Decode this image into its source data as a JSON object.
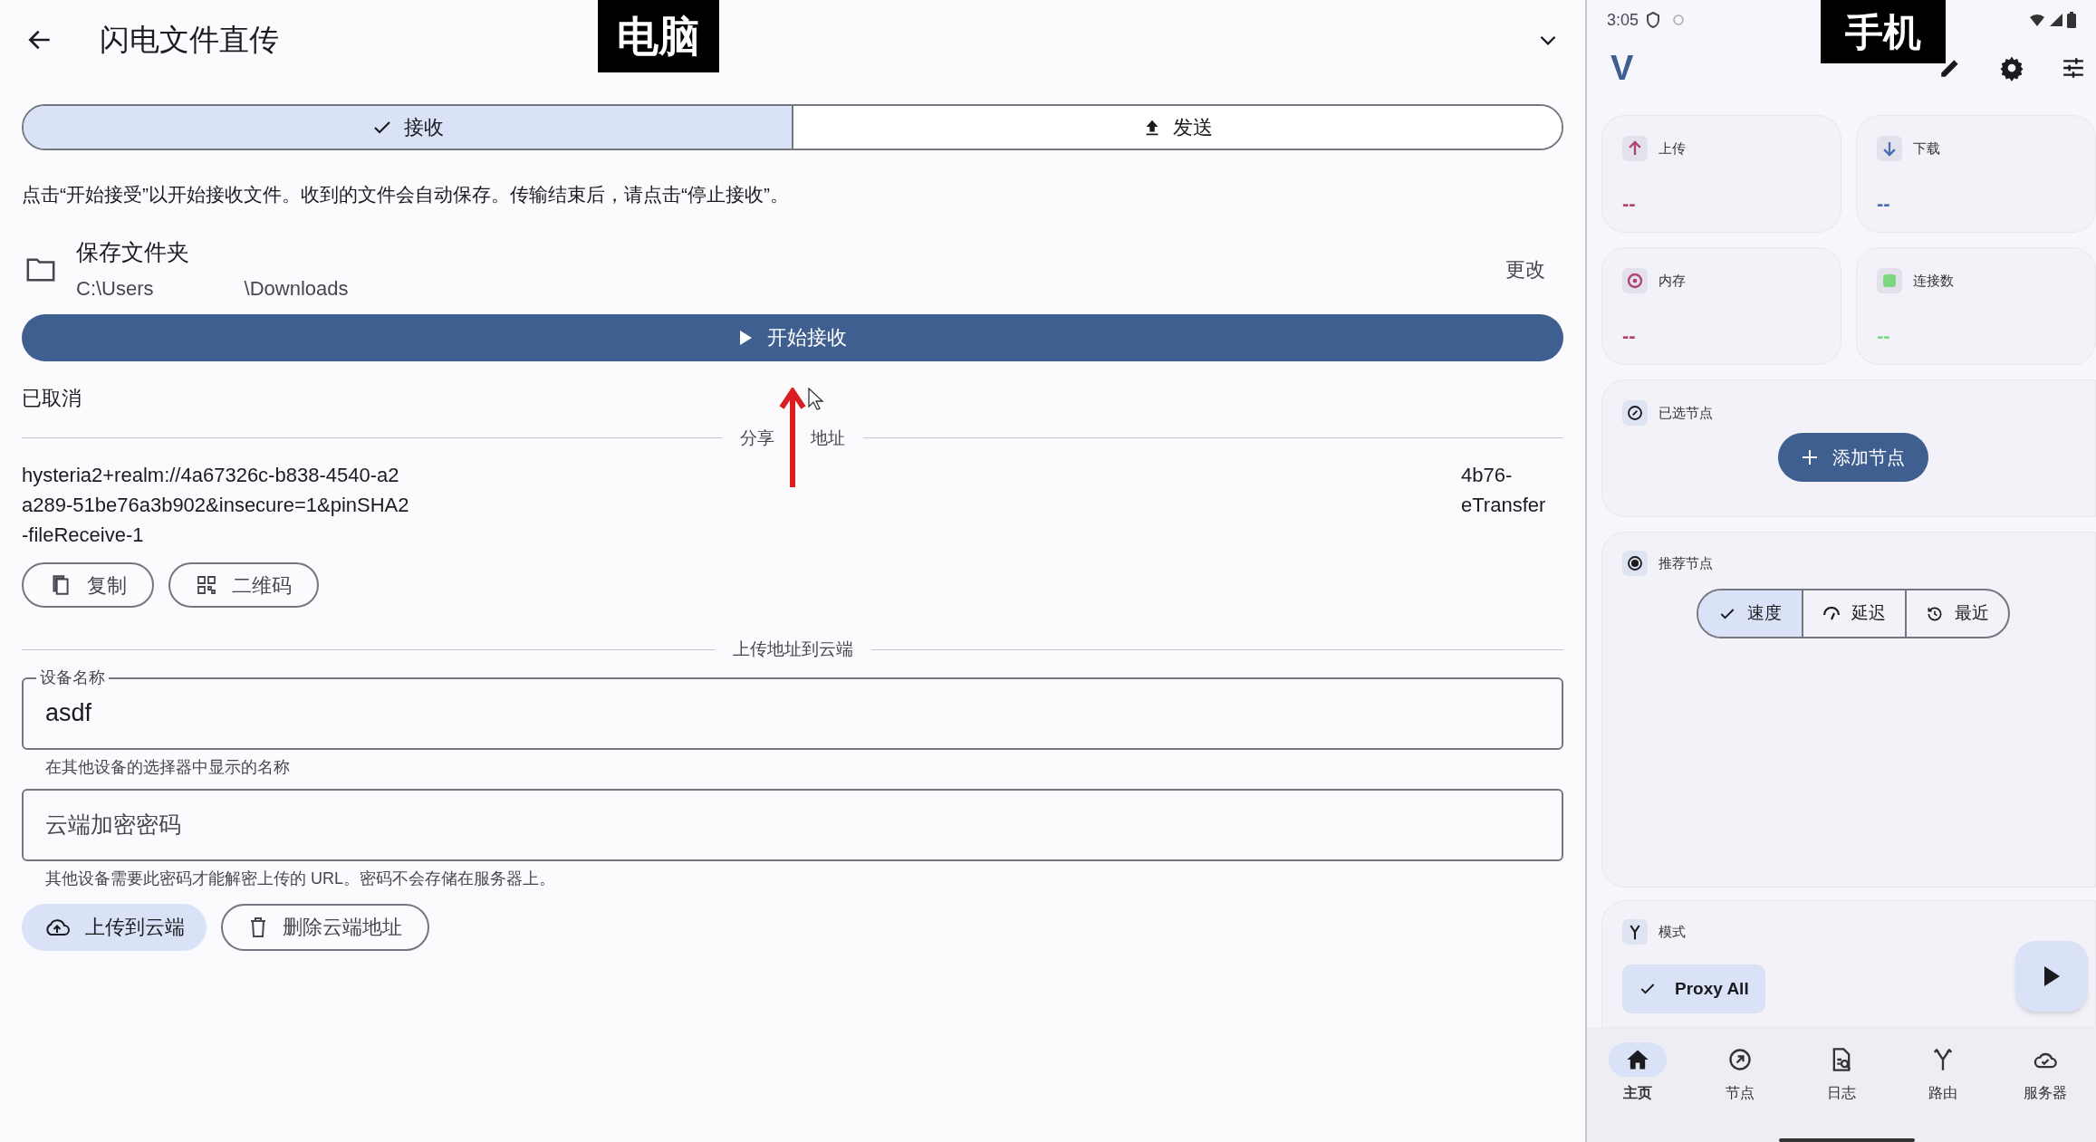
{
  "annotations": {
    "desktop_label": "电脑",
    "phone_label": "手机"
  },
  "desktop": {
    "title": "闪电文件直传",
    "tabs": [
      {
        "label": "接收",
        "kind": "receive",
        "selected": true
      },
      {
        "label": "发送",
        "kind": "send",
        "selected": false
      }
    ],
    "instruction": "点击“开始接受”以开始接收文件。收到的文件会自动保存。传输结束后，请点击“停止接收”。",
    "folder": {
      "label": "保存文件夹",
      "path_start": "C:\\Users",
      "path_end": "\\Downloads",
      "change": "更改"
    },
    "start_button": "开始接收",
    "status": "已取消",
    "share_divider": {
      "left": "分享",
      "right": "地址"
    },
    "share_url": [
      {
        "left": "hysteria2+realm://4a67326c-b838-4540-a2",
        "right": "4b76-"
      },
      {
        "left": "a289-51be76a3b902&insecure=1&pinSHA2",
        "right": "eTransfer"
      },
      {
        "left": "-fileReceive-1"
      }
    ],
    "share_buttons": [
      {
        "label": "复制",
        "kind": "copy"
      },
      {
        "label": "二维码",
        "kind": "qr"
      }
    ],
    "upload_divider": "上传地址到云端",
    "device_field": {
      "label": "设备名称",
      "value": "asdf",
      "helper": "在其他设备的选择器中显示的名称"
    },
    "password_field": {
      "placeholder": "云端加密密码",
      "helper": "其他设备需要此密码才能解密上传的 URL。密码不会存储在服务器上。"
    },
    "cloud_buttons": [
      {
        "label": "上传到云端",
        "kind": "upload",
        "filled": true
      },
      {
        "label": "删除云端地址",
        "kind": "delete",
        "filled": false
      }
    ]
  },
  "phone": {
    "status_bar": {
      "time": "3:05"
    },
    "logo": "V",
    "stats": [
      {
        "label": "上传",
        "value": "--",
        "kind": "upload",
        "color": "#b0446e"
      },
      {
        "label": "下载",
        "value": "--",
        "kind": "download",
        "color": "#4a6fb0"
      },
      {
        "label": "内存",
        "value": "--",
        "kind": "memory",
        "color": "#b0446e"
      },
      {
        "label": "连接数",
        "value": "--",
        "kind": "connections",
        "color": "#7cd87c"
      }
    ],
    "selected_node": {
      "title": "已选节点",
      "button": "添加节点"
    },
    "recommended": {
      "title": "推荐节点",
      "segments": [
        {
          "label": "速度",
          "kind": "speed",
          "selected": true
        },
        {
          "label": "延迟",
          "kind": "latency",
          "selected": false
        },
        {
          "label": "最近",
          "kind": "recent",
          "selected": false
        }
      ]
    },
    "mode": {
      "title": "模式",
      "chip": "Proxy All",
      "chip_selected": true
    },
    "nav": [
      {
        "label": "主页",
        "kind": "home",
        "selected": true
      },
      {
        "label": "节点",
        "kind": "node",
        "selected": false
      },
      {
        "label": "日志",
        "kind": "log",
        "selected": false
      },
      {
        "label": "路由",
        "kind": "route",
        "selected": false
      },
      {
        "label": "服务器",
        "kind": "server",
        "selected": false
      }
    ]
  }
}
